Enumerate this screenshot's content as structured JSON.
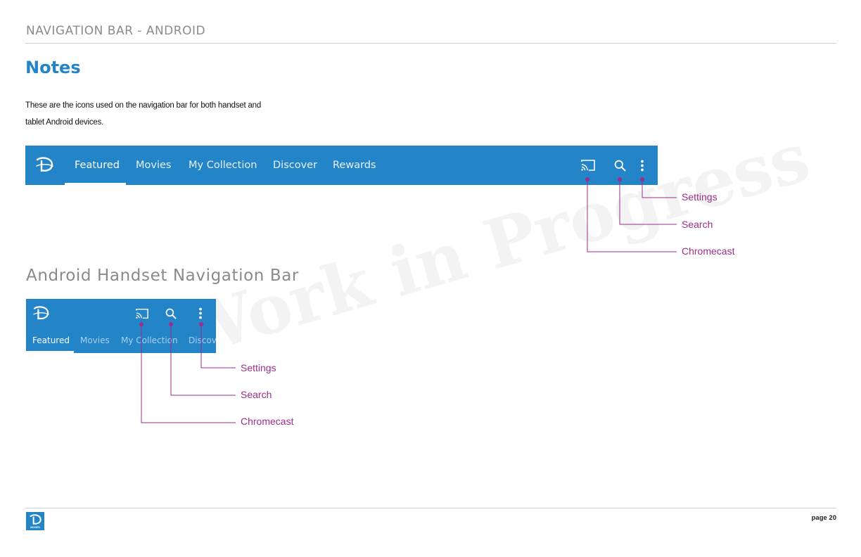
{
  "header": {
    "title": "NAVIGATION BAR - ANDROID"
  },
  "notes": {
    "heading": "Notes",
    "body": "These are the icons used on the navigation bar for both handset and tablet Android devices."
  },
  "watermark": "Work in Progress",
  "tablet_nav": {
    "tabs": [
      "Featured",
      "Movies",
      "My Collection",
      "Discover",
      "Rewards"
    ],
    "active_tab": "Featured",
    "icons": [
      "disney-logo-icon",
      "chromecast-icon",
      "search-icon",
      "overflow-menu-icon"
    ],
    "callouts": [
      "Settings",
      "Search",
      "Chromecast"
    ]
  },
  "handset": {
    "heading": "Android Handset Navigation Bar",
    "tabs": [
      "Featured",
      "Movies",
      "My Collection",
      "Discover"
    ],
    "active_tab": "Featured",
    "icons": [
      "disney-logo-icon",
      "chromecast-icon",
      "search-icon",
      "overflow-menu-icon"
    ],
    "callouts": [
      "Settings",
      "Search",
      "Chromecast"
    ]
  },
  "footer": {
    "logo_caption": "MOVIES",
    "page": "page 20"
  },
  "colors": {
    "brand_blue": "#2384c8",
    "callout_magenta": "#9b2d8b",
    "heading_gray": "#8a8a8a"
  }
}
